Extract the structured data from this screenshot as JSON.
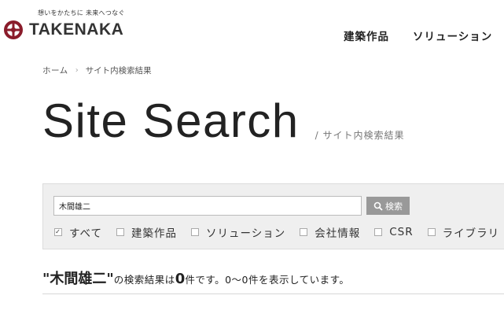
{
  "header": {
    "tagline": "想いをかたちに 未来へつなぐ",
    "logo_text": "TAKENAKA",
    "nav": [
      {
        "label": "建築作品"
      },
      {
        "label": "ソリューション"
      }
    ]
  },
  "breadcrumb": {
    "home": "ホーム",
    "separator": "›",
    "current": "サイト内検索結果"
  },
  "page": {
    "title": "Site Search",
    "subtitle": "/ サイト内検索結果"
  },
  "search": {
    "query": "木間雄二",
    "button_label": "検索",
    "filters": [
      {
        "label": "すべて",
        "checked": true
      },
      {
        "label": "建築作品",
        "checked": false
      },
      {
        "label": "ソリューション",
        "checked": false
      },
      {
        "label": "会社情報",
        "checked": false
      },
      {
        "label": "CSR",
        "checked": false
      },
      {
        "label": "ライブラリ",
        "checked": false
      }
    ]
  },
  "results": {
    "query_display": "\"木間雄二\"",
    "text_before_count": "の検索結果は",
    "count": "0",
    "text_after_count": "件です。0〜0件を表示しています。"
  },
  "colors": {
    "logo_accent": "#8a1c2b",
    "panel_bg": "#efefef",
    "button_bg": "#999999"
  }
}
